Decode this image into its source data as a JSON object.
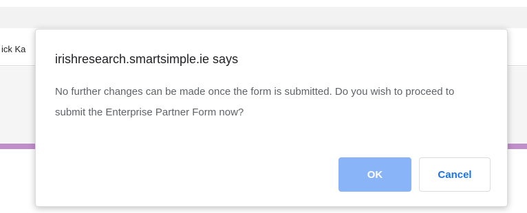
{
  "background": {
    "user_name_fragment": "ick Ka",
    "accent_color": "#c08fca"
  },
  "dialog": {
    "title": "irishresearch.smartsimple.ie says",
    "message": "No further changes can be made once the form is submitted. Do you wish to proceed to submit the Enterprise Partner Form now?",
    "ok_label": "OK",
    "cancel_label": "Cancel",
    "ok_color": "#8ab4f8",
    "cancel_text_color": "#1a73e8"
  }
}
